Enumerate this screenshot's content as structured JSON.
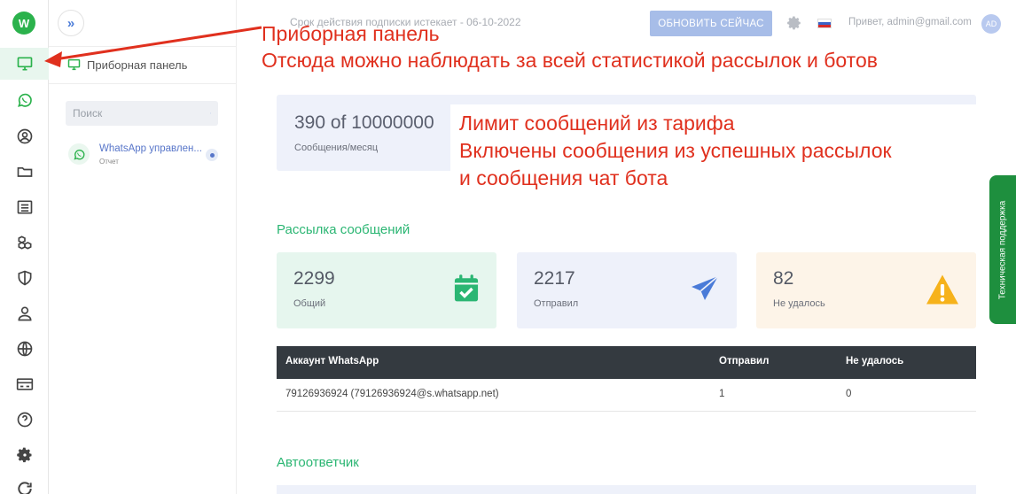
{
  "app": {
    "logo_letter": "W"
  },
  "rail": {
    "icons": [
      "monitor-icon",
      "whatsapp-icon",
      "user-circle-icon",
      "folder-icon",
      "list-icon",
      "cubes-icon",
      "shield-icon",
      "person-icon",
      "globe-icon",
      "card-icon",
      "help-icon",
      "gear-icon",
      "refresh-icon"
    ],
    "active": "monitor-icon"
  },
  "sidebar": {
    "expand_symbol": "»",
    "title": "Приборная панель",
    "search_placeholder": "Поиск",
    "account": {
      "name": "WhatsApp управлен...",
      "sub": "Отчет"
    }
  },
  "topbar": {
    "notice": "Срок действия подписки истекает - 06-10-2022",
    "update_button": "ОБНОВИТЬ СЕЙЧАС",
    "greeting": "Привет, admin@gmail.com",
    "avatar": "AD"
  },
  "limit": {
    "value": "390 of 10000000",
    "label": "Сообщения/месяц"
  },
  "broadcast": {
    "title": "Рассылка сообщений",
    "cards": [
      {
        "value": "2299",
        "label": "Общий",
        "bg": "#e6f6ee",
        "icon": "calendar-check-icon"
      },
      {
        "value": "2217",
        "label": "Отправил",
        "bg": "#eef1fa",
        "icon": "paper-plane-icon"
      },
      {
        "value": "82",
        "label": "Не удалось",
        "bg": "#fdf4e8",
        "icon": "warning-icon"
      }
    ]
  },
  "table": {
    "headers": [
      "Аккаунт WhatsApp",
      "Отправил",
      "Не удалось"
    ],
    "rows": [
      [
        "79126936924 (79126936924@s.whatsapp.net)",
        "1",
        "0"
      ]
    ]
  },
  "autoresponder": {
    "title": "Автоответчик"
  },
  "support": {
    "label": "Техническая поддержка"
  },
  "annotations": {
    "dashboard_line1": "Приборная панель",
    "dashboard_line2": "Отсюда можно наблюдать за всей статистикой рассылок и ботов",
    "limit_line1": "Лимит сообщений из тарифа",
    "limit_line2": "Включены сообщения из успешных рассылок",
    "limit_line3": "и сообщения чат бота"
  }
}
